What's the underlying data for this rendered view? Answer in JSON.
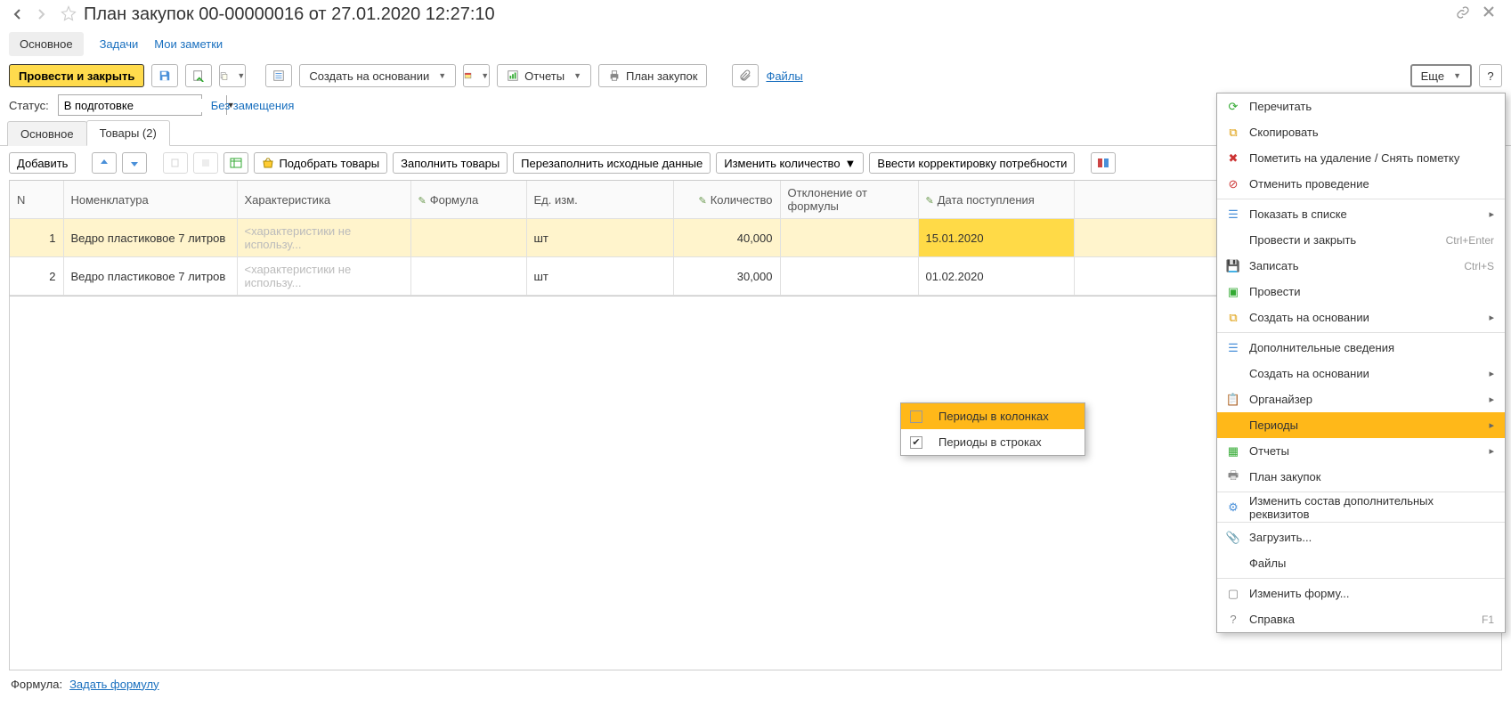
{
  "title": "План закупок 00-00000016 от 27.01.2020 12:27:10",
  "sections": {
    "main": "Основное",
    "tasks": "Задачи",
    "notes": "Мои заметки"
  },
  "cmdbar": {
    "post_close": "Провести и закрыть",
    "create_based": "Создать на основании",
    "reports": "Отчеты",
    "plan": "План закупок",
    "files": "Файлы",
    "more": "Еще",
    "help": "?"
  },
  "status": {
    "label": "Статус:",
    "value": "В подготовке",
    "no_sub": "Без замещения"
  },
  "tabs": {
    "main": "Основное",
    "products": "Товары (2)"
  },
  "ptoolbar": {
    "add": "Добавить",
    "pick": "Подобрать товары",
    "fill": "Заполнить товары",
    "refill": "Перезаполнить исходные данные",
    "chqty": "Изменить количество",
    "corr": "Ввести корректировку потребности"
  },
  "columns": {
    "n": "N",
    "nom": "Номенклатура",
    "char": "Характеристика",
    "formula": "Формула",
    "unit": "Ед. изм.",
    "qty": "Количество",
    "dev": "Отклонение от формулы",
    "date": "Дата поступления"
  },
  "rows": [
    {
      "n": "1",
      "nom": "Ведро пластиковое 7 литров",
      "char": "<характеристики не использу...",
      "formula": "",
      "unit": "шт",
      "qty": "40,000",
      "dev": "",
      "date": "15.01.2020"
    },
    {
      "n": "2",
      "nom": "Ведро пластиковое 7 литров",
      "char": "<характеристики не использу...",
      "formula": "",
      "unit": "шт",
      "qty": "30,000",
      "dev": "",
      "date": "01.02.2020"
    }
  ],
  "formula": {
    "label": "Формула:",
    "link": "Задать формулу"
  },
  "menu": {
    "reread": "Перечитать",
    "copy": "Скопировать",
    "mark_del": "Пометить на удаление / Снять пометку",
    "cancel_post": "Отменить проведение",
    "show_list": "Показать в списке",
    "post_close": "Провести и закрыть",
    "post_close_sh": "Ctrl+Enter",
    "save": "Записать",
    "save_sh": "Ctrl+S",
    "post": "Провести",
    "create_based": "Создать на основании",
    "extra": "Дополнительные сведения",
    "create_based2": "Создать на основании",
    "organizer": "Органайзер",
    "periods": "Периоды",
    "reports": "Отчеты",
    "plan": "План закупок",
    "edit_req": "Изменить состав дополнительных реквизитов",
    "load": "Загрузить...",
    "files": "Файлы",
    "edit_form": "Изменить форму...",
    "help": "Справка",
    "help_sh": "F1"
  },
  "submenu": {
    "in_cols": "Периоды в колонках",
    "in_rows": "Периоды в строках"
  }
}
